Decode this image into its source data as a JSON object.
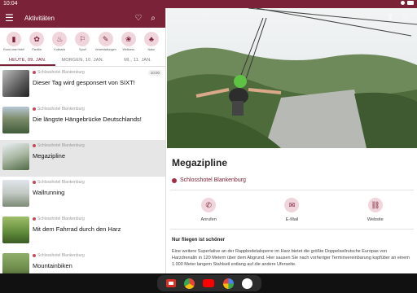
{
  "status": {
    "time": "10:04"
  },
  "appbar": {
    "title": "Aktivitäten",
    "menu_icon": "menu-icon",
    "fav_icon": "heart-icon",
    "search_icon": "search-icon"
  },
  "categories": [
    {
      "label": "Rund ums Hotel",
      "icon": "hotel-icon",
      "glyph": "▮"
    },
    {
      "label": "Familie",
      "icon": "family-icon",
      "glyph": "✿"
    },
    {
      "label": "Kulinarik",
      "icon": "cutlery-icon",
      "glyph": "♨"
    },
    {
      "label": "Sport",
      "icon": "sport-icon",
      "glyph": "⚐"
    },
    {
      "label": "Veranstaltungen",
      "icon": "ticket-icon",
      "glyph": "✎"
    },
    {
      "label": "Wellness",
      "icon": "wellness-icon",
      "glyph": "❀"
    },
    {
      "label": "Natur",
      "icon": "nature-icon",
      "glyph": "♣"
    }
  ],
  "tabs": [
    {
      "label": "HEUTE, 09. JAN.",
      "active": true
    },
    {
      "label": "MORGEN, 10. JAN.",
      "active": false
    },
    {
      "label": "MI., 11. JAN.",
      "active": false
    }
  ],
  "list": [
    {
      "location": "Schlosshotel Blankenburg",
      "title": "Dieser Tag wird gesponsert von SIXT!",
      "time": "10:00",
      "selected": false
    },
    {
      "location": "Schlosshotel Blankenburg",
      "title": "Die längste Hängebrücke Deutschlands!",
      "time": "",
      "selected": false
    },
    {
      "location": "Schlosshotel Blankenburg",
      "title": "Megazipline",
      "time": "",
      "selected": true
    },
    {
      "location": "Schlosshotel Blankenburg",
      "title": "Wallrunning",
      "time": "",
      "selected": false
    },
    {
      "location": "Schlosshotel Blankenburg",
      "title": "Mit dem Fahrrad durch den Harz",
      "time": "",
      "selected": false
    },
    {
      "location": "Schlosshotel Blankenburg",
      "title": "Mountainbiken",
      "time": "",
      "selected": false
    }
  ],
  "detail": {
    "title": "Megazipline",
    "location": "Schlosshotel Blankenburg",
    "actions": [
      {
        "label": "Anrufen",
        "icon": "phone-icon",
        "glyph": "✆"
      },
      {
        "label": "E-Mail",
        "icon": "mail-icon",
        "glyph": "✉"
      },
      {
        "label": "Website",
        "icon": "link-icon",
        "glyph": "⛓"
      }
    ],
    "section_title": "Nur fliegen ist schöner",
    "description": "Eine weitere Superlative an der Rappbodetalsperre im Harz bietet die größte Doppelseilrutsche Europas von Harzdrenalin in 120 Metern über dem Abgrund. Hier sausen Sie nach vorheriger Terminvereinbarung kopfüber an einem 1.000 Meter langem Stahlseil entlang auf die andere Uferseite."
  },
  "colors": {
    "brand": "#7a2238",
    "accent_light": "#f0d6dc"
  }
}
